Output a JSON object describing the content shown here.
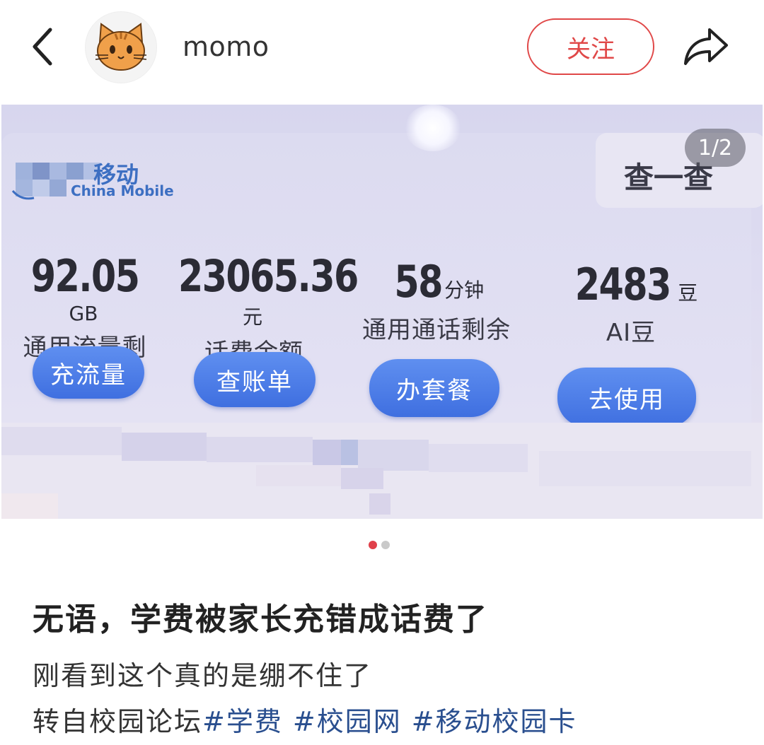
{
  "header": {
    "username": "momo",
    "follow_label": "关注"
  },
  "photo": {
    "pager": "1/2",
    "carrier_logo_text": "移动",
    "carrier_logo_sub": "China Mobile",
    "query_label": "查一查",
    "stats": [
      {
        "value": "92.05",
        "unit": "GB",
        "label": "通用流量剩余",
        "button": "充流量"
      },
      {
        "value": "23065.36",
        "unit": "元",
        "label": "话费余额",
        "button": "查账单"
      },
      {
        "value": "58",
        "unit": "分钟",
        "label": "通用通话剩余",
        "button": "办套餐"
      },
      {
        "value": "2483",
        "unit": "豆",
        "label": "AI豆",
        "button": "去使用"
      }
    ]
  },
  "carousel": {
    "current": 1,
    "total": 2
  },
  "post": {
    "title": "无语，学费被家长充错成话费了",
    "body": "刚看到这个真的是绷不住了",
    "prefix": "转自校园论坛",
    "tags": [
      "#学费",
      "#校园网",
      "#移动校园卡"
    ]
  },
  "colors": {
    "accent_red": "#e04848",
    "tag_blue": "#2a4f8f",
    "button_blue": "#4a7ae6"
  }
}
